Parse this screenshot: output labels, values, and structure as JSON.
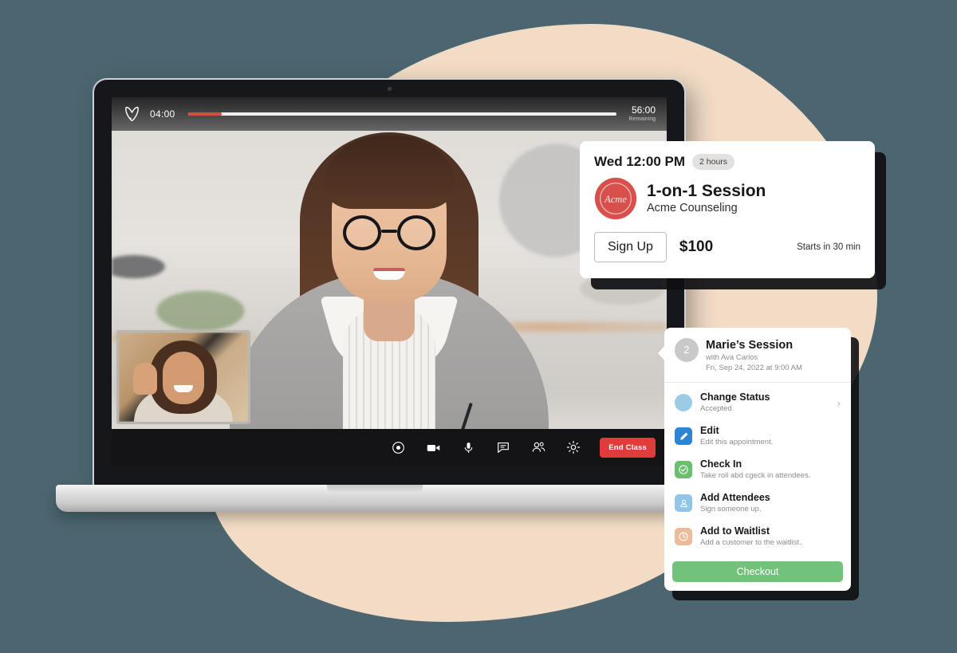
{
  "theme": {
    "background": "#4b6670",
    "blob": "#f2dcc6",
    "accent_red": "#e23b3b",
    "accent_green": "#72c27c",
    "progress_red": "#d94a42"
  },
  "laptop": {
    "video_call": {
      "topbar": {
        "brand_icon": "vectera-v-logo-icon",
        "elapsed": "04:00",
        "remaining": "56:00",
        "remaining_label": "Remaining",
        "progress_percent": 8
      },
      "pip": {
        "label": "self-view"
      },
      "toolbar": {
        "buttons": [
          {
            "icon": "record-icon",
            "name": "record-button"
          },
          {
            "icon": "camera-icon",
            "name": "camera-button"
          },
          {
            "icon": "microphone-icon",
            "name": "microphone-button"
          },
          {
            "icon": "chat-icon",
            "name": "chat-button"
          },
          {
            "icon": "participants-icon",
            "name": "participants-button"
          },
          {
            "icon": "gear-icon",
            "name": "settings-button"
          }
        ],
        "end_class_label": "End Class"
      }
    }
  },
  "signup_card": {
    "time": "Wed 12:00 PM",
    "duration": "2 hours",
    "logo_text": "Acme",
    "title": "1-on-1 Session",
    "organization": "Acme Counseling",
    "button_label": "Sign Up",
    "price": "$100",
    "starts_in": "Starts in 30 min"
  },
  "action_menu": {
    "badge": "2",
    "title": "Marie’s Session",
    "with_line": "with Ava Carlos",
    "date_line": "Fri, Sep 24, 2022 at 9:00 AM",
    "items": [
      {
        "label": "Change Status",
        "desc": "Accepted.",
        "icon": "status-circle-icon",
        "icon_color": "#9ccbe8",
        "shape": "round",
        "chevron": "›"
      },
      {
        "label": "Edit",
        "desc": "Edit this appointment.",
        "icon": "pencil-icon",
        "icon_color": "#2d84d0",
        "shape": "square",
        "chevron": ""
      },
      {
        "label": "Check In",
        "desc": "Take roll abd cgeck in attendees.",
        "icon": "check-circle-icon",
        "icon_color": "#6cbf6f",
        "shape": "square",
        "chevron": ""
      },
      {
        "label": "Add Attendees",
        "desc": "Sign someone up.",
        "icon": "person-add-icon",
        "icon_color": "#92c6e8",
        "shape": "square",
        "chevron": ""
      },
      {
        "label": "Add to Waitlist",
        "desc": "Add a customer to the waitlist.",
        "icon": "clock-icon",
        "icon_color": "#eebb9a",
        "shape": "square",
        "chevron": ""
      }
    ],
    "checkout_label": "Checkout"
  }
}
